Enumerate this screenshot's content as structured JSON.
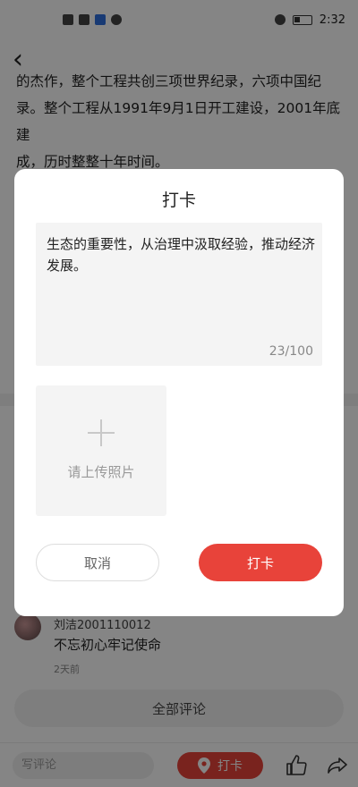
{
  "status_bar": {
    "time": "2:32"
  },
  "article": {
    "lines": [
      "的杰作，整个工程共创三项世界纪录，六项中国纪",
      "录。整个工程从1991年9月1日开工建设，2001年底建",
      "成，历时整整十年时间。"
    ]
  },
  "comment": {
    "name": "刘洁2001110012",
    "text": "不忘初心牢记使命",
    "time": "2天前"
  },
  "all_comments_label": "全部评论",
  "bottom_bar": {
    "write_placeholder": "写评论",
    "checkin_label": "打卡"
  },
  "dialog": {
    "title": "打卡",
    "text_value": "生态的重要性，从治理中汲取经验，推动经济发展。",
    "counter": "23/100",
    "upload_label": "请上传照片",
    "cancel_label": "取消",
    "confirm_label": "打卡"
  },
  "colors": {
    "accent": "#e8433a",
    "overlay": "rgba(0,0,0,0.48)"
  },
  "icons": [
    "back-icon",
    "plus-icon",
    "location-pin-icon",
    "thumbs-up-icon",
    "share-icon"
  ]
}
